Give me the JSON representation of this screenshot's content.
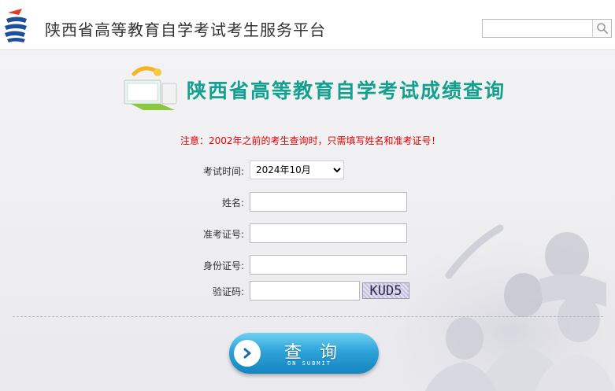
{
  "header": {
    "site_title": "陕西省高等教育自学考试考生服务平台",
    "search": {
      "placeholder": "",
      "icon": "search-icon"
    }
  },
  "main": {
    "banner_title": "陕西省高等教育自学考试成绩查询",
    "notice": "注意：2002年之前的考生查询时，只需填写姓名和准考证号！",
    "form": {
      "exam_time": {
        "label": "考试时间:",
        "selected": "2024年10月"
      },
      "name": {
        "label": "姓名:",
        "value": ""
      },
      "ticket_no": {
        "label": "准考证号:",
        "value": ""
      },
      "id_no": {
        "label": "身份证号:",
        "value": ""
      },
      "captcha": {
        "label": "验证码:",
        "value": "",
        "image_text": "KUD5"
      }
    },
    "submit": {
      "label": "查 询",
      "sublabel": "ON SUBMIT",
      "icon": "chevron-right-icon"
    }
  },
  "colors": {
    "accent": "#13a08e",
    "notice": "#e00000",
    "button": "#2da3d8"
  }
}
